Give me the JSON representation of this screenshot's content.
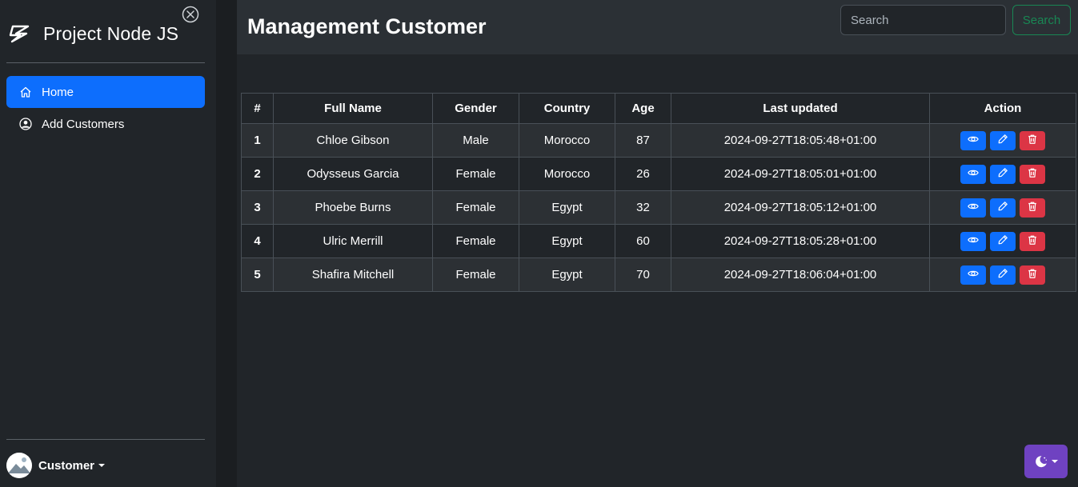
{
  "sidebar": {
    "brand": "Project Node JS",
    "nav": [
      {
        "label": "Home",
        "icon": "home-icon",
        "active": true
      },
      {
        "label": "Add Customers",
        "icon": "user-circle-icon",
        "active": false
      }
    ],
    "user": {
      "name": "Customer"
    }
  },
  "header": {
    "title": "Management Customer",
    "search_placeholder": "Search",
    "search_button": "Search"
  },
  "table": {
    "columns": [
      "#",
      "Full Name",
      "Gender",
      "Country",
      "Age",
      "Last updated",
      "Action"
    ],
    "rows": [
      {
        "num": "1",
        "name": "Chloe Gibson",
        "gender": "Male",
        "country": "Morocco",
        "age": "87",
        "updated": "2024-09-27T18:05:48+01:00"
      },
      {
        "num": "2",
        "name": "Odysseus Garcia",
        "gender": "Female",
        "country": "Morocco",
        "age": "26",
        "updated": "2024-09-27T18:05:01+01:00"
      },
      {
        "num": "3",
        "name": "Phoebe Burns",
        "gender": "Female",
        "country": "Egypt",
        "age": "32",
        "updated": "2024-09-27T18:05:12+01:00"
      },
      {
        "num": "4",
        "name": "Ulric Merrill",
        "gender": "Female",
        "country": "Egypt",
        "age": "60",
        "updated": "2024-09-27T18:05:28+01:00"
      },
      {
        "num": "5",
        "name": "Shafira Mitchell",
        "gender": "Female",
        "country": "Egypt",
        "age": "70",
        "updated": "2024-09-27T18:06:04+01:00"
      }
    ]
  },
  "colors": {
    "primary": "#0d6efd",
    "danger": "#dc3545",
    "success": "#198754",
    "theme_toggle": "#6f42c1"
  }
}
